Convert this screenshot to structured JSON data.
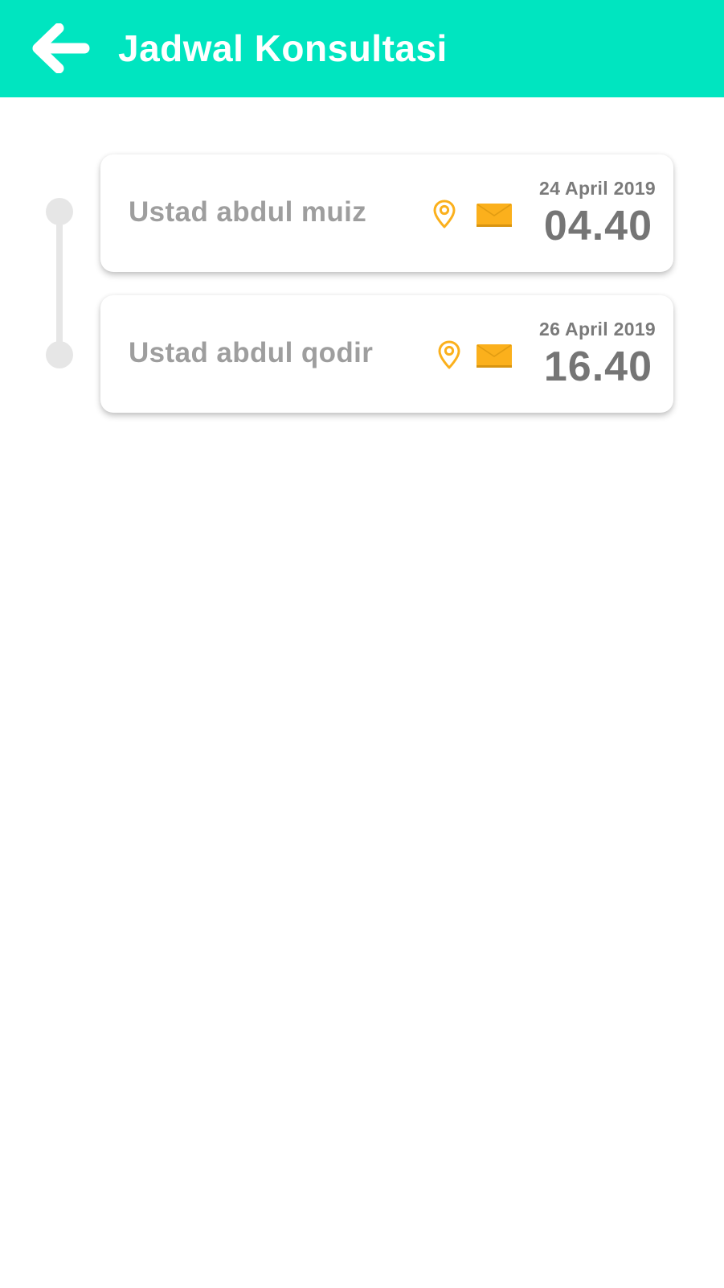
{
  "header": {
    "title": "Jadwal Konsultasi",
    "back_icon": "arrow-left-icon",
    "background_color": "#00e5c0"
  },
  "schedule": [
    {
      "name": "Ustad abdul muiz",
      "date": "24 April 2019",
      "time": "04.40",
      "location_icon": "location-pin-icon",
      "message_icon": "mail-icon"
    },
    {
      "name": "Ustad abdul qodir",
      "date": "26 April 2019",
      "time": "16.40",
      "location_icon": "location-pin-icon",
      "message_icon": "mail-icon"
    }
  ],
  "colors": {
    "accent": "#00e5c0",
    "icon": "#fbb01c",
    "text_muted": "#9e9e9e",
    "timeline": "#e6e6e6"
  }
}
